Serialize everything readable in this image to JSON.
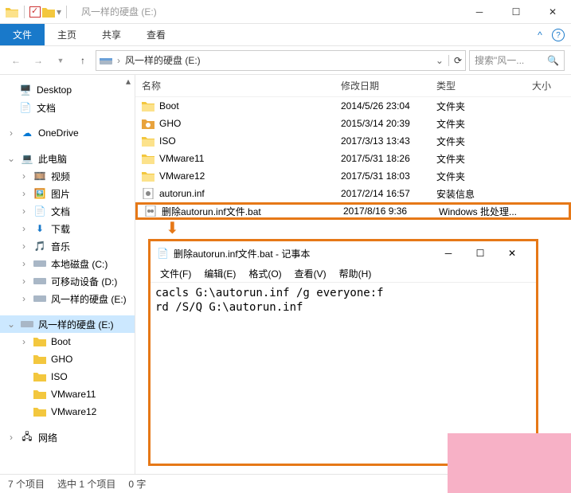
{
  "titlebar": {
    "title": "风一样的硬盘 (E:)"
  },
  "ribbon": {
    "file": "文件",
    "tabs": [
      "主页",
      "共享",
      "查看"
    ]
  },
  "nav": {
    "breadcrumb": [
      "风一样的硬盘 (E:)"
    ],
    "search_placeholder": "搜索\"风一..."
  },
  "tree": {
    "desktop": "Desktop",
    "docs_quick": "文档",
    "onedrive": "OneDrive",
    "thispc": "此电脑",
    "videos": "视频",
    "pictures": "图片",
    "documents": "文档",
    "downloads": "下载",
    "music": "音乐",
    "drive_c": "本地磁盘 (C:)",
    "drive_d": "可移动设备 (D:)",
    "drive_e1": "风一样的硬盘 (E:)",
    "drive_e2": "风一样的硬盘 (E:)",
    "boot": "Boot",
    "gho": "GHO",
    "iso": "ISO",
    "vmware11": "VMware11",
    "vmware12": "VMware12",
    "network": "网络"
  },
  "columns": {
    "name": "名称",
    "date": "修改日期",
    "type": "类型",
    "size": "大小"
  },
  "files": [
    {
      "icon": "folder",
      "name": "Boot",
      "date": "2014/5/26 23:04",
      "type": "文件夹"
    },
    {
      "icon": "gho",
      "name": "GHO",
      "date": "2015/3/14 20:39",
      "type": "文件夹"
    },
    {
      "icon": "folder",
      "name": "ISO",
      "date": "2017/3/13 13:43",
      "type": "文件夹"
    },
    {
      "icon": "folder",
      "name": "VMware11",
      "date": "2017/5/31 18:26",
      "type": "文件夹"
    },
    {
      "icon": "folder",
      "name": "VMware12",
      "date": "2017/5/31 18:03",
      "type": "文件夹"
    },
    {
      "icon": "inf",
      "name": "autorun.inf",
      "date": "2017/2/14 16:57",
      "type": "安装信息"
    },
    {
      "icon": "bat",
      "name": "删除autorun.inf文件.bat",
      "date": "2017/8/16 9:36",
      "type": "Windows 批处理..."
    }
  ],
  "notepad": {
    "title": "删除autorun.inf文件.bat - 记事本",
    "menu": {
      "file": "文件(F)",
      "edit": "编辑(E)",
      "format": "格式(O)",
      "view": "查看(V)",
      "help": "帮助(H)"
    },
    "content": "cacls G:\\autorun.inf /g everyone:f\nrd /S/Q G:\\autorun.inf"
  },
  "status": {
    "count": "7 个项目",
    "selected": "选中 1 个项目",
    "bytes": "0 字"
  }
}
